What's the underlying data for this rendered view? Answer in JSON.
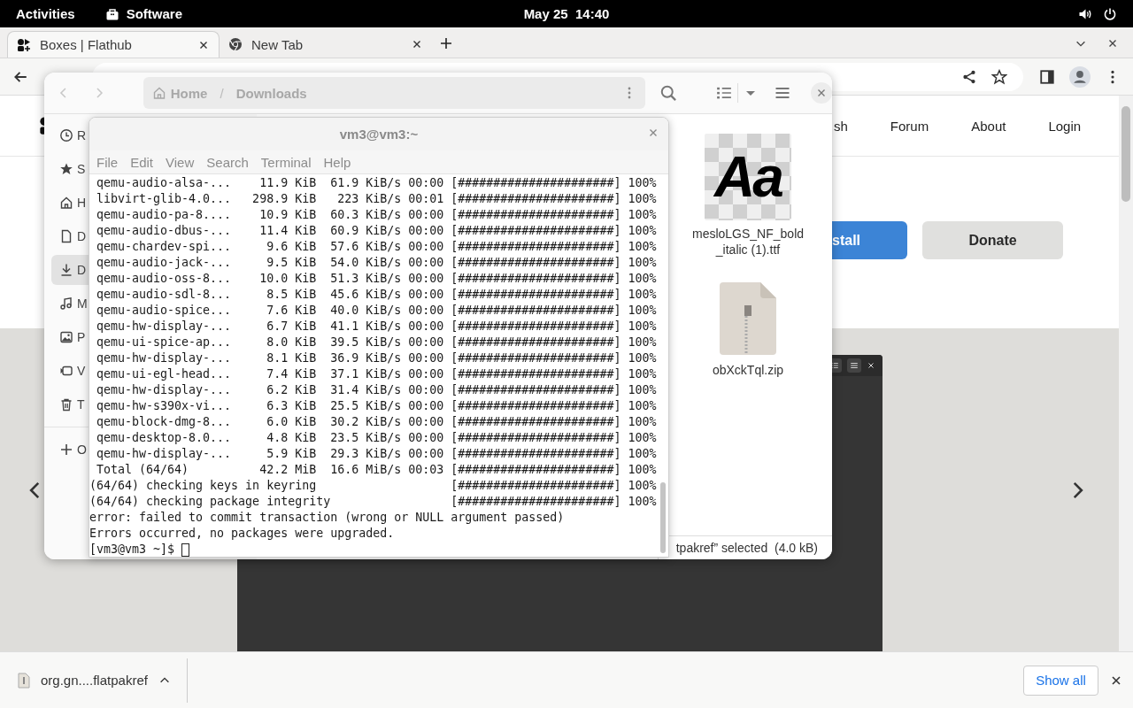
{
  "top_bar": {
    "activities": "Activities",
    "app": "Software",
    "clock": "May 25  14:40"
  },
  "browser": {
    "tabs": [
      {
        "title": "Boxes | Flathub",
        "selected": true
      },
      {
        "title": "New Tab",
        "selected": false
      }
    ],
    "page": {
      "nav": [
        "sh",
        "Forum",
        "About",
        "Login"
      ],
      "buttons": [
        {
          "label": "stall",
          "kind": "primary"
        },
        {
          "label": "Donate",
          "kind": "secondary"
        }
      ]
    },
    "download_bar": {
      "file": "org.gn....flatpakref",
      "show_all": "Show all"
    }
  },
  "files": {
    "path_separator": "/",
    "path": [
      {
        "label": "Home",
        "kind": "home"
      },
      {
        "label": "Downloads",
        "kind": "folder"
      }
    ],
    "sidebar": [
      {
        "label": "R",
        "kind": "recent",
        "selected": false
      },
      {
        "label": "S",
        "kind": "starred",
        "selected": false
      },
      {
        "label": "H",
        "kind": "home",
        "selected": false
      },
      {
        "label": "D",
        "kind": "documents",
        "selected": false
      },
      {
        "label": "D",
        "kind": "downloads",
        "selected": true
      },
      {
        "label": "M",
        "kind": "music",
        "selected": false
      },
      {
        "label": "P",
        "kind": "pictures",
        "selected": false
      },
      {
        "label": "V",
        "kind": "videos",
        "selected": false
      },
      {
        "label": "T",
        "kind": "trash",
        "selected": false
      },
      {
        "label": "O",
        "kind": "other",
        "selected": false
      }
    ],
    "items": [
      {
        "kind": "font",
        "preview": "Aa",
        "name_lines": [
          "mesloLGS_NF_bold",
          "_italic (1).ttf"
        ]
      },
      {
        "kind": "archive",
        "name_lines": [
          "obXckTql.zip"
        ]
      }
    ],
    "status": "tpakref” selected  (4.0 kB)"
  },
  "terminal": {
    "title": "vm3@vm3:~",
    "menu": [
      "File",
      "Edit",
      "View",
      "Search",
      "Terminal",
      "Help"
    ],
    "lines": [
      {
        "kind": "transfer",
        "name": "qemu-audio-alsa-...",
        "size": "11.9 KiB",
        "rate": "61.9 KiB/s",
        "time": "00:00",
        "bar": "[######################]",
        "percent": "100%"
      },
      {
        "kind": "transfer",
        "name": "libvirt-glib-4.0...",
        "size": "298.9 KiB",
        "rate": "223 KiB/s",
        "time": "00:01",
        "bar": "[######################]",
        "percent": "100%"
      },
      {
        "kind": "transfer",
        "name": "qemu-audio-pa-8....",
        "size": "10.9 KiB",
        "rate": "60.3 KiB/s",
        "time": "00:00",
        "bar": "[######################]",
        "percent": "100%"
      },
      {
        "kind": "transfer",
        "name": "qemu-audio-dbus-...",
        "size": "11.4 KiB",
        "rate": "60.9 KiB/s",
        "time": "00:00",
        "bar": "[######################]",
        "percent": "100%"
      },
      {
        "kind": "transfer",
        "name": "qemu-chardev-spi...",
        "size": "9.6 KiB",
        "rate": "57.6 KiB/s",
        "time": "00:00",
        "bar": "[######################]",
        "percent": "100%"
      },
      {
        "kind": "transfer",
        "name": "qemu-audio-jack-...",
        "size": "9.5 KiB",
        "rate": "54.0 KiB/s",
        "time": "00:00",
        "bar": "[######################]",
        "percent": "100%"
      },
      {
        "kind": "transfer",
        "name": "qemu-audio-oss-8...",
        "size": "10.0 KiB",
        "rate": "51.3 KiB/s",
        "time": "00:00",
        "bar": "[######################]",
        "percent": "100%"
      },
      {
        "kind": "transfer",
        "name": "qemu-audio-sdl-8...",
        "size": "8.5 KiB",
        "rate": "45.6 KiB/s",
        "time": "00:00",
        "bar": "[######################]",
        "percent": "100%"
      },
      {
        "kind": "transfer",
        "name": "qemu-audio-spice...",
        "size": "7.6 KiB",
        "rate": "40.0 KiB/s",
        "time": "00:00",
        "bar": "[######################]",
        "percent": "100%"
      },
      {
        "kind": "transfer",
        "name": "qemu-hw-display-...",
        "size": "6.7 KiB",
        "rate": "41.1 KiB/s",
        "time": "00:00",
        "bar": "[######################]",
        "percent": "100%"
      },
      {
        "kind": "transfer",
        "name": "qemu-ui-spice-ap...",
        "size": "8.0 KiB",
        "rate": "39.5 KiB/s",
        "time": "00:00",
        "bar": "[######################]",
        "percent": "100%"
      },
      {
        "kind": "transfer",
        "name": "qemu-hw-display-...",
        "size": "8.1 KiB",
        "rate": "36.9 KiB/s",
        "time": "00:00",
        "bar": "[######################]",
        "percent": "100%"
      },
      {
        "kind": "transfer",
        "name": "qemu-ui-egl-head...",
        "size": "7.4 KiB",
        "rate": "37.1 KiB/s",
        "time": "00:00",
        "bar": "[######################]",
        "percent": "100%"
      },
      {
        "kind": "transfer",
        "name": "qemu-hw-display-...",
        "size": "6.2 KiB",
        "rate": "31.4 KiB/s",
        "time": "00:00",
        "bar": "[######################]",
        "percent": "100%"
      },
      {
        "kind": "transfer",
        "name": "qemu-hw-s390x-vi...",
        "size": "6.3 KiB",
        "rate": "25.5 KiB/s",
        "time": "00:00",
        "bar": "[######################]",
        "percent": "100%"
      },
      {
        "kind": "transfer",
        "name": "qemu-block-dmg-8...",
        "size": "6.0 KiB",
        "rate": "30.2 KiB/s",
        "time": "00:00",
        "bar": "[######################]",
        "percent": "100%"
      },
      {
        "kind": "transfer",
        "name": "qemu-desktop-8.0...",
        "size": "4.8 KiB",
        "rate": "23.5 KiB/s",
        "time": "00:00",
        "bar": "[######################]",
        "percent": "100%"
      },
      {
        "kind": "transfer",
        "name": "qemu-hw-display-...",
        "size": "5.9 KiB",
        "rate": "29.3 KiB/s",
        "time": "00:00",
        "bar": "[######################]",
        "percent": "100%"
      },
      {
        "kind": "transfer",
        "name": "Total (64/64)",
        "size": "42.2 MiB",
        "rate": "16.6 MiB/s",
        "time": "00:03",
        "bar": "[######################]",
        "percent": "100%"
      },
      {
        "kind": "check",
        "text": "(64/64) checking keys in keyring",
        "bar": "[######################]",
        "percent": "100%"
      },
      {
        "kind": "check",
        "text": "(64/64) checking package integrity",
        "bar": "[######################]",
        "percent": "100%"
      },
      {
        "kind": "text",
        "text": "error: failed to commit transaction (wrong or NULL argument passed)"
      },
      {
        "kind": "text",
        "text": "Errors occurred, no packages were upgraded."
      },
      {
        "kind": "prompt",
        "text": "[vm3@vm3 ~]$"
      }
    ]
  }
}
